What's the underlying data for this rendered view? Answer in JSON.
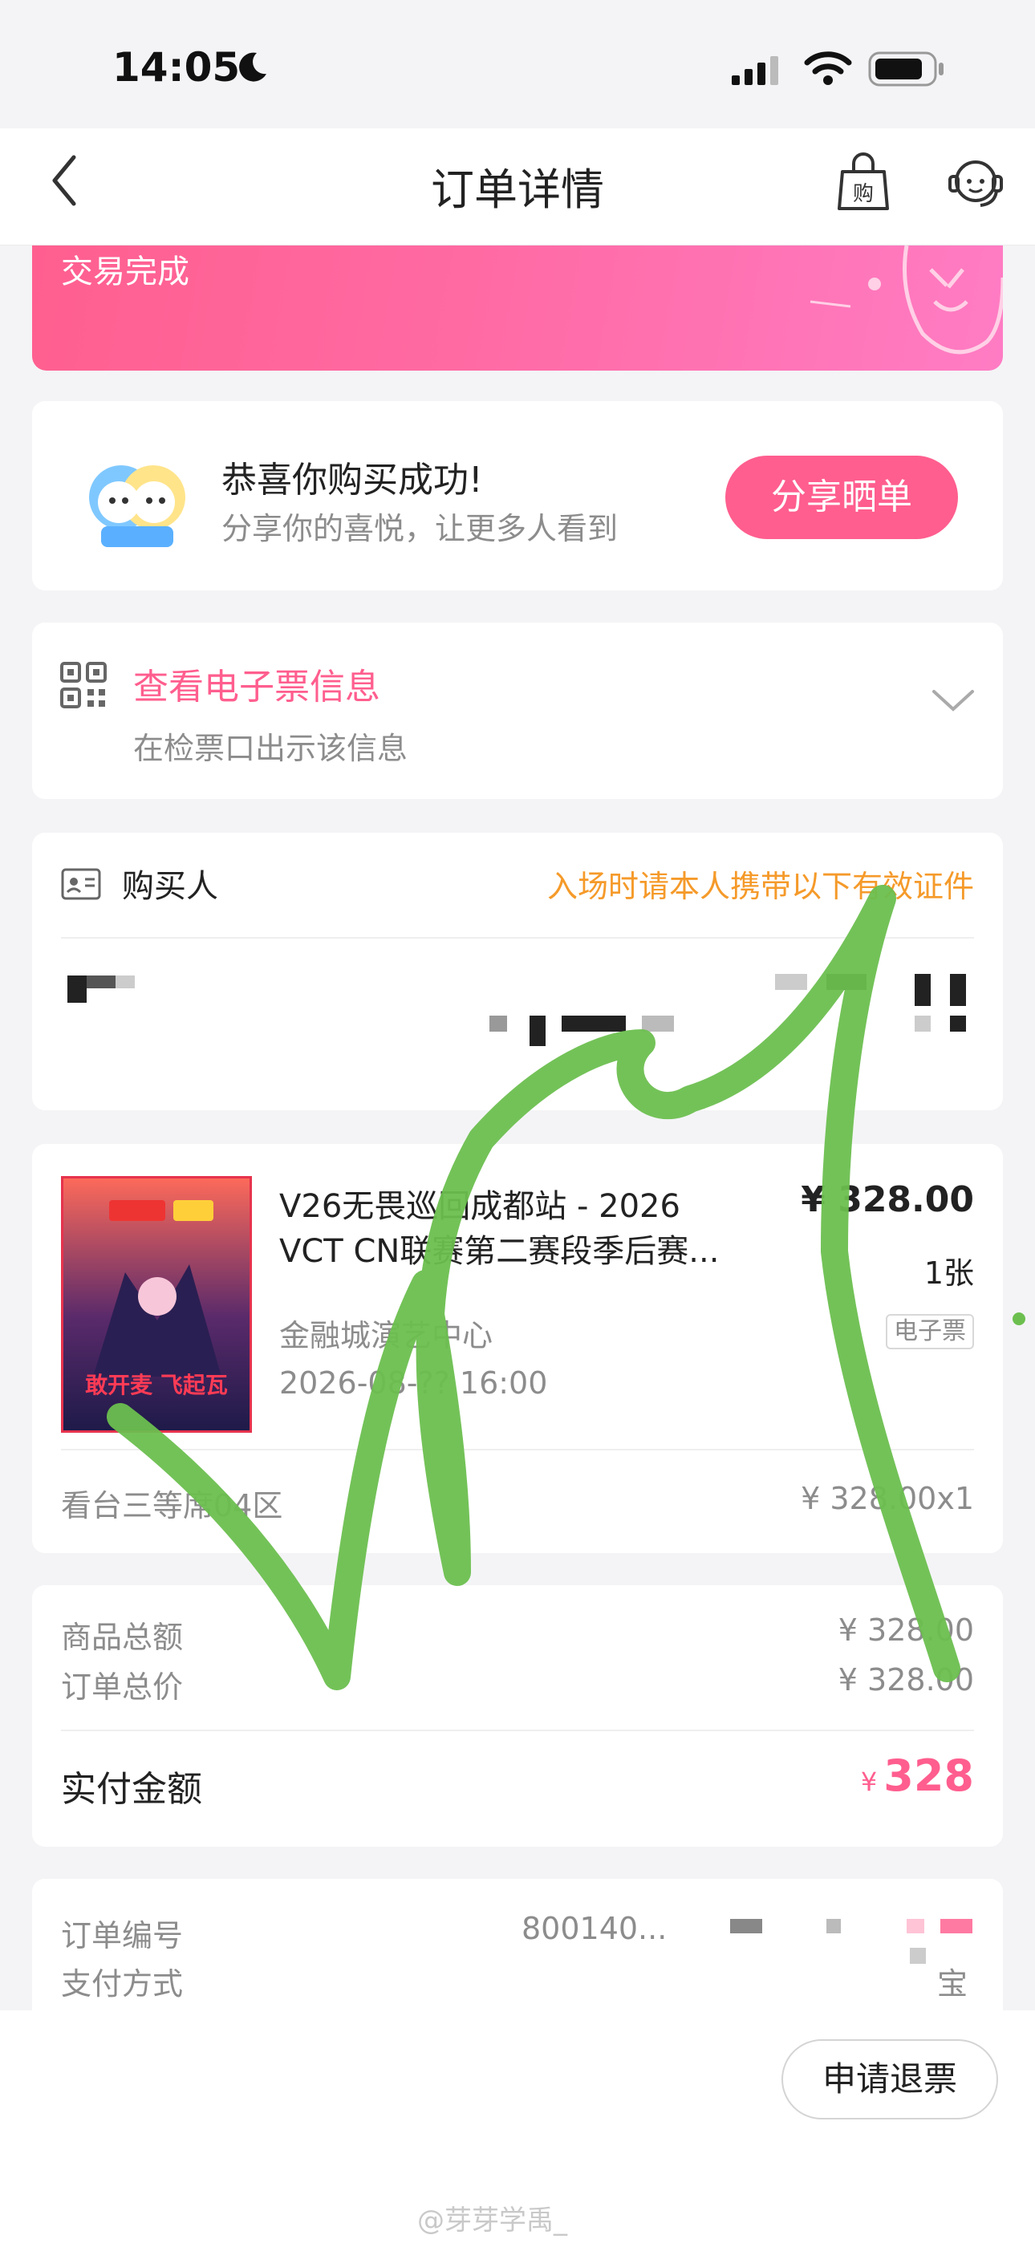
{
  "status_bar": {
    "time": "14:05"
  },
  "nav": {
    "title": "订单详情"
  },
  "banner": {
    "status_text": "交易完成"
  },
  "share_card": {
    "title": "恭喜你购买成功!",
    "subtitle": "分享你的喜悦，让更多人看到",
    "button": "分享晒单"
  },
  "eticket": {
    "title": "查看电子票信息",
    "subtitle": "在检票口出示该信息"
  },
  "buyer": {
    "label": "购买人",
    "note": "入场时请本人携带以下有效证件"
  },
  "event": {
    "title": "V26无畏巡回成都站 - 2026 VCT CN联赛第二赛段季后赛...",
    "price": "¥ 328.00",
    "quantity": "1张",
    "venue": "金融城演艺中心",
    "ticket_type": "电子票",
    "datetime": "2026-08-?? 16:00",
    "seat": "看台三等席04区",
    "seat_price": "¥ 328.00x1",
    "poster_text": "敢开麦 飞起瓦"
  },
  "summary": {
    "goods_total_label": "商品总额",
    "goods_total": "¥ 328.00",
    "order_total_label": "订单总价",
    "order_total": "¥ 328.00",
    "paid_label": "实付金额",
    "paid_currency": "¥",
    "paid_amount": "328"
  },
  "order_info": {
    "order_no_label": "订单编号",
    "order_no": "800140...",
    "pay_method_label": "支付方式",
    "pay_method": "宝"
  },
  "bottom": {
    "refund_button": "申请退票"
  },
  "watermark": "@芽芽学禹_",
  "colors": {
    "accent": "#ff5e8e",
    "note": "#f59a2a",
    "scribble": "#6cbf4f"
  }
}
